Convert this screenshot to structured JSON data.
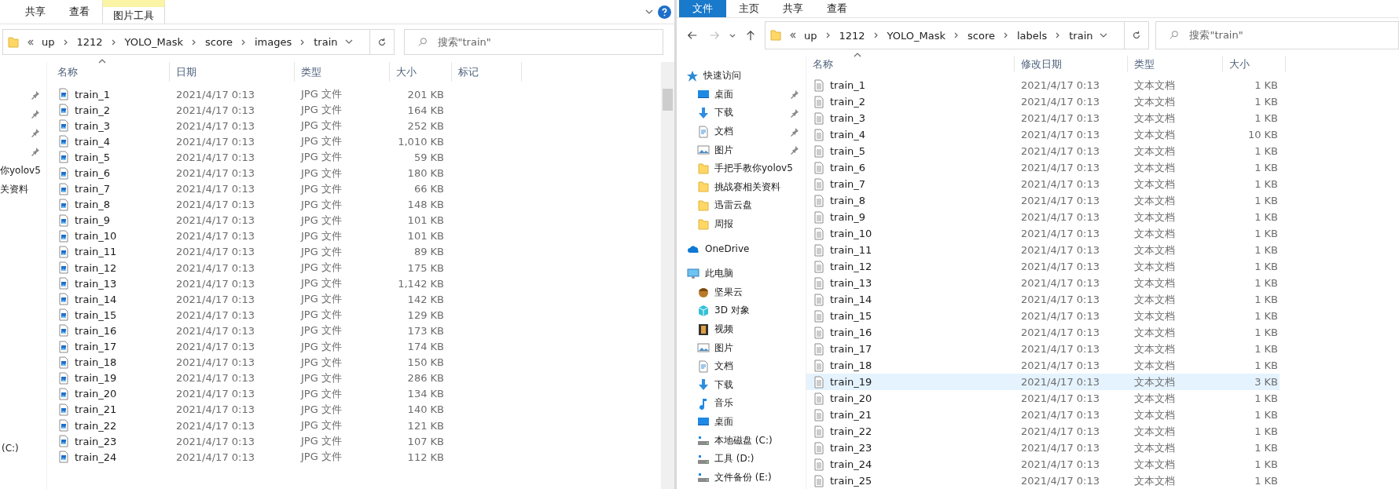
{
  "windows": [
    {
      "ribbon_tabs": [
        {
          "kind": "tab",
          "label": "共享",
          "selected": false
        },
        {
          "kind": "tab",
          "label": "查看",
          "selected": false
        },
        {
          "kind": "tool",
          "label": "图片工具",
          "selected": true
        }
      ],
      "ribbon_controls": true,
      "breadcrumb": [
        "up",
        "1212",
        "YOLO_Mask",
        "score",
        "images",
        "train"
      ],
      "search": {
        "placeholder": "搜索\"train\""
      },
      "nav_fragments": [
        {
          "kind": "pin"
        },
        {
          "kind": "pin"
        },
        {
          "kind": "pin"
        },
        {
          "kind": "pin"
        },
        {
          "kind": "text",
          "label": "你yolov5"
        },
        {
          "kind": "text",
          "label": "关资料"
        },
        {
          "kind": "drive",
          "label": "(C:)"
        }
      ],
      "columns": [
        {
          "label": "名称",
          "sorted": true
        },
        {
          "label": "日期",
          "sorted": false
        },
        {
          "label": "类型",
          "sorted": false
        },
        {
          "label": "大小",
          "sorted": false
        },
        {
          "label": "标记",
          "sorted": false
        }
      ],
      "kind": "image",
      "rows": [
        {
          "name": "train_1",
          "date": "2021/4/17 0:13",
          "type": "JPG 文件",
          "size": "201 KB",
          "selected": false
        },
        {
          "name": "train_2",
          "date": "2021/4/17 0:13",
          "type": "JPG 文件",
          "size": "164 KB",
          "selected": false
        },
        {
          "name": "train_3",
          "date": "2021/4/17 0:13",
          "type": "JPG 文件",
          "size": "252 KB",
          "selected": false
        },
        {
          "name": "train_4",
          "date": "2021/4/17 0:13",
          "type": "JPG 文件",
          "size": "1,010 KB",
          "selected": false
        },
        {
          "name": "train_5",
          "date": "2021/4/17 0:13",
          "type": "JPG 文件",
          "size": "59 KB",
          "selected": false
        },
        {
          "name": "train_6",
          "date": "2021/4/17 0:13",
          "type": "JPG 文件",
          "size": "180 KB",
          "selected": false
        },
        {
          "name": "train_7",
          "date": "2021/4/17 0:13",
          "type": "JPG 文件",
          "size": "66 KB",
          "selected": false
        },
        {
          "name": "train_8",
          "date": "2021/4/17 0:13",
          "type": "JPG 文件",
          "size": "148 KB",
          "selected": false
        },
        {
          "name": "train_9",
          "date": "2021/4/17 0:13",
          "type": "JPG 文件",
          "size": "101 KB",
          "selected": false
        },
        {
          "name": "train_10",
          "date": "2021/4/17 0:13",
          "type": "JPG 文件",
          "size": "101 KB",
          "selected": false
        },
        {
          "name": "train_11",
          "date": "2021/4/17 0:13",
          "type": "JPG 文件",
          "size": "89 KB",
          "selected": false
        },
        {
          "name": "train_12",
          "date": "2021/4/17 0:13",
          "type": "JPG 文件",
          "size": "175 KB",
          "selected": false
        },
        {
          "name": "train_13",
          "date": "2021/4/17 0:13",
          "type": "JPG 文件",
          "size": "1,142 KB",
          "selected": false
        },
        {
          "name": "train_14",
          "date": "2021/4/17 0:13",
          "type": "JPG 文件",
          "size": "142 KB",
          "selected": false
        },
        {
          "name": "train_15",
          "date": "2021/4/17 0:13",
          "type": "JPG 文件",
          "size": "129 KB",
          "selected": false
        },
        {
          "name": "train_16",
          "date": "2021/4/17 0:13",
          "type": "JPG 文件",
          "size": "173 KB",
          "selected": false
        },
        {
          "name": "train_17",
          "date": "2021/4/17 0:13",
          "type": "JPG 文件",
          "size": "174 KB",
          "selected": false
        },
        {
          "name": "train_18",
          "date": "2021/4/17 0:13",
          "type": "JPG 文件",
          "size": "150 KB",
          "selected": false
        },
        {
          "name": "train_19",
          "date": "2021/4/17 0:13",
          "type": "JPG 文件",
          "size": "286 KB",
          "selected": false
        },
        {
          "name": "train_20",
          "date": "2021/4/17 0:13",
          "type": "JPG 文件",
          "size": "134 KB",
          "selected": false
        },
        {
          "name": "train_21",
          "date": "2021/4/17 0:13",
          "type": "JPG 文件",
          "size": "140 KB",
          "selected": false
        },
        {
          "name": "train_22",
          "date": "2021/4/17 0:13",
          "type": "JPG 文件",
          "size": "121 KB",
          "selected": false
        },
        {
          "name": "train_23",
          "date": "2021/4/17 0:13",
          "type": "JPG 文件",
          "size": "107 KB",
          "selected": false
        },
        {
          "name": "train_24",
          "date": "2021/4/17 0:13",
          "type": "JPG 文件",
          "size": "112 KB",
          "selected": false
        }
      ]
    },
    {
      "ribbon_tabs": [
        {
          "kind": "file",
          "label": "文件",
          "selected": false
        },
        {
          "kind": "tab",
          "label": "主页",
          "selected": false
        },
        {
          "kind": "tab",
          "label": "共享",
          "selected": false
        },
        {
          "kind": "tab",
          "label": "查看",
          "selected": false
        }
      ],
      "ribbon_controls": false,
      "nav_buttons": true,
      "breadcrumb": [
        "up",
        "1212",
        "YOLO_Mask",
        "score",
        "labels",
        "train"
      ],
      "search": {
        "placeholder": "搜索\"train\""
      },
      "nav": [
        {
          "kind": "star",
          "label": "快速访问",
          "children": [
            {
              "kind": "desktop",
              "label": "桌面",
              "pinned": true
            },
            {
              "kind": "download",
              "label": "下载",
              "pinned": true
            },
            {
              "kind": "document",
              "label": "文档",
              "pinned": true
            },
            {
              "kind": "picture",
              "label": "图片",
              "pinned": true
            },
            {
              "kind": "folder",
              "label": "手把手教你yolov5",
              "pinned": false
            },
            {
              "kind": "folder",
              "label": "挑战赛相关资料",
              "pinned": false
            },
            {
              "kind": "folder",
              "label": "迅雷云盘",
              "pinned": false
            },
            {
              "kind": "folder",
              "label": "周报",
              "pinned": false
            }
          ]
        },
        {
          "kind": "cloud",
          "label": "OneDrive"
        },
        {
          "kind": "pc",
          "label": "此电脑",
          "children": [
            {
              "kind": "acorn",
              "label": "坚果云"
            },
            {
              "kind": "cube",
              "label": "3D 对象"
            },
            {
              "kind": "film",
              "label": "视频"
            },
            {
              "kind": "picture",
              "label": "图片"
            },
            {
              "kind": "document",
              "label": "文档"
            },
            {
              "kind": "download",
              "label": "下载"
            },
            {
              "kind": "music",
              "label": "音乐"
            },
            {
              "kind": "desktop",
              "label": "桌面"
            },
            {
              "kind": "disk",
              "label": "本地磁盘 (C:)"
            },
            {
              "kind": "disk",
              "label": "工具 (D:)"
            },
            {
              "kind": "disk",
              "label": "文件备份 (E:)"
            }
          ]
        }
      ],
      "columns": [
        {
          "label": "名称",
          "sorted": true
        },
        {
          "label": "修改日期",
          "sorted": false
        },
        {
          "label": "类型",
          "sorted": false
        },
        {
          "label": "大小",
          "sorted": false
        }
      ],
      "kind": "text",
      "rows": [
        {
          "name": "train_1",
          "date": "2021/4/17 0:13",
          "type": "文本文档",
          "size": "1 KB",
          "selected": false
        },
        {
          "name": "train_2",
          "date": "2021/4/17 0:13",
          "type": "文本文档",
          "size": "1 KB",
          "selected": false
        },
        {
          "name": "train_3",
          "date": "2021/4/17 0:13",
          "type": "文本文档",
          "size": "1 KB",
          "selected": false
        },
        {
          "name": "train_4",
          "date": "2021/4/17 0:13",
          "type": "文本文档",
          "size": "10 KB",
          "selected": false
        },
        {
          "name": "train_5",
          "date": "2021/4/17 0:13",
          "type": "文本文档",
          "size": "1 KB",
          "selected": false
        },
        {
          "name": "train_6",
          "date": "2021/4/17 0:13",
          "type": "文本文档",
          "size": "1 KB",
          "selected": false
        },
        {
          "name": "train_7",
          "date": "2021/4/17 0:13",
          "type": "文本文档",
          "size": "1 KB",
          "selected": false
        },
        {
          "name": "train_8",
          "date": "2021/4/17 0:13",
          "type": "文本文档",
          "size": "1 KB",
          "selected": false
        },
        {
          "name": "train_9",
          "date": "2021/4/17 0:13",
          "type": "文本文档",
          "size": "1 KB",
          "selected": false
        },
        {
          "name": "train_10",
          "date": "2021/4/17 0:13",
          "type": "文本文档",
          "size": "1 KB",
          "selected": false
        },
        {
          "name": "train_11",
          "date": "2021/4/17 0:13",
          "type": "文本文档",
          "size": "1 KB",
          "selected": false
        },
        {
          "name": "train_12",
          "date": "2021/4/17 0:13",
          "type": "文本文档",
          "size": "1 KB",
          "selected": false
        },
        {
          "name": "train_13",
          "date": "2021/4/17 0:13",
          "type": "文本文档",
          "size": "1 KB",
          "selected": false
        },
        {
          "name": "train_14",
          "date": "2021/4/17 0:13",
          "type": "文本文档",
          "size": "1 KB",
          "selected": false
        },
        {
          "name": "train_15",
          "date": "2021/4/17 0:13",
          "type": "文本文档",
          "size": "1 KB",
          "selected": false
        },
        {
          "name": "train_16",
          "date": "2021/4/17 0:13",
          "type": "文本文档",
          "size": "1 KB",
          "selected": false
        },
        {
          "name": "train_17",
          "date": "2021/4/17 0:13",
          "type": "文本文档",
          "size": "1 KB",
          "selected": false
        },
        {
          "name": "train_18",
          "date": "2021/4/17 0:13",
          "type": "文本文档",
          "size": "1 KB",
          "selected": false
        },
        {
          "name": "train_19",
          "date": "2021/4/17 0:13",
          "type": "文本文档",
          "size": "3 KB",
          "selected": true
        },
        {
          "name": "train_20",
          "date": "2021/4/17 0:13",
          "type": "文本文档",
          "size": "1 KB",
          "selected": false
        },
        {
          "name": "train_21",
          "date": "2021/4/17 0:13",
          "type": "文本文档",
          "size": "1 KB",
          "selected": false
        },
        {
          "name": "train_22",
          "date": "2021/4/17 0:13",
          "type": "文本文档",
          "size": "1 KB",
          "selected": false
        },
        {
          "name": "train_23",
          "date": "2021/4/17 0:13",
          "type": "文本文档",
          "size": "1 KB",
          "selected": false
        },
        {
          "name": "train_24",
          "date": "2021/4/17 0:13",
          "type": "文本文档",
          "size": "1 KB",
          "selected": false
        },
        {
          "name": "train_25",
          "date": "2021/4/17 0:13",
          "type": "文本文档",
          "size": "1 KB",
          "selected": false
        }
      ]
    }
  ]
}
